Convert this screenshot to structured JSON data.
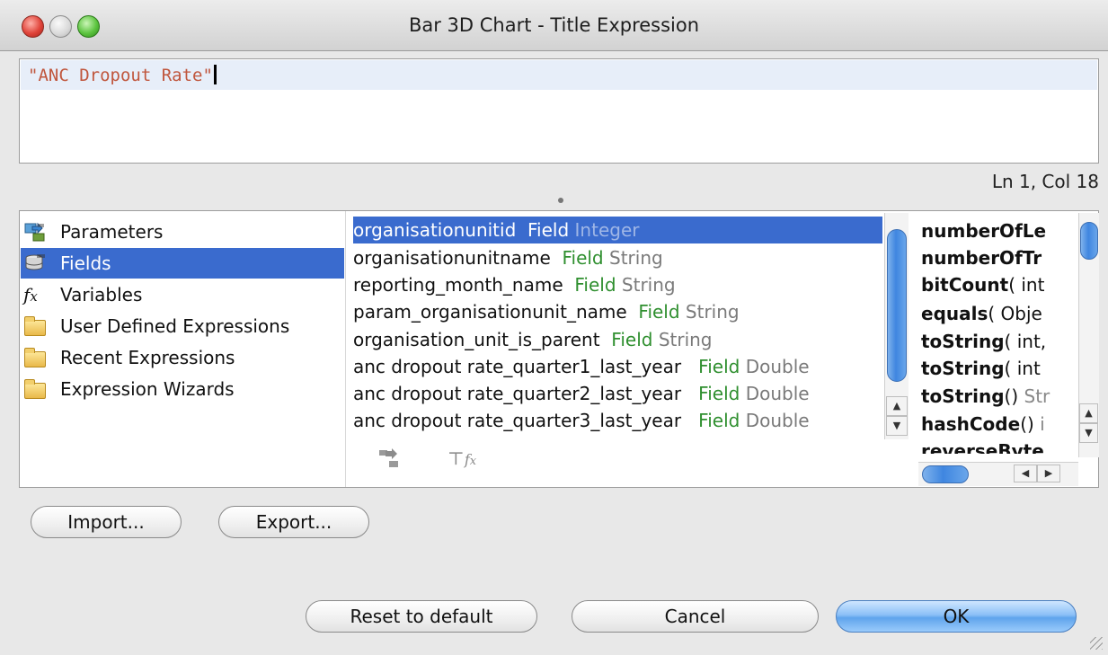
{
  "window": {
    "title": "Bar 3D Chart - Title Expression"
  },
  "editor": {
    "text": "\"ANC Dropout Rate\"",
    "cursor_position": "Ln 1, Col 18"
  },
  "tree": {
    "items": [
      {
        "label": "Parameters",
        "icon": "parameters-icon"
      },
      {
        "label": "Fields",
        "icon": "fields-icon",
        "selected": true
      },
      {
        "label": "Variables",
        "icon": "fx-icon"
      },
      {
        "label": "User Defined Expressions",
        "icon": "folder-icon"
      },
      {
        "label": "Recent Expressions",
        "icon": "folder-icon"
      },
      {
        "label": "Expression Wizards",
        "icon": "folder-icon"
      }
    ]
  },
  "fields": {
    "rows": [
      {
        "name": "organisationunitid",
        "kind": "Field",
        "type": "Integer",
        "selected": true
      },
      {
        "name": "organisationunitname",
        "kind": "Field",
        "type": "String"
      },
      {
        "name": "reporting_month_name",
        "kind": "Field",
        "type": "String"
      },
      {
        "name": "param_organisationunit_name",
        "kind": "Field",
        "type": "String"
      },
      {
        "name": "organisation_unit_is_parent",
        "kind": "Field",
        "type": "String"
      },
      {
        "name": "anc dropout rate_quarter1_last_year",
        "kind": "Field",
        "type": "Double"
      },
      {
        "name": "anc dropout rate_quarter2_last_year",
        "kind": "Field",
        "type": "Double"
      },
      {
        "name": "anc dropout rate_quarter3_last_year",
        "kind": "Field",
        "type": "Double"
      }
    ]
  },
  "methods": {
    "rows": [
      {
        "name": "numberOfLe",
        "args": "",
        "ret": ""
      },
      {
        "name": "numberOfTr",
        "args": "",
        "ret": ""
      },
      {
        "name": "bitCount",
        "args": "( int",
        "ret": ""
      },
      {
        "name": "equals",
        "args": "( Obje",
        "ret": ""
      },
      {
        "name": "toString",
        "args": "( int,",
        "ret": ""
      },
      {
        "name": "toString",
        "args": "( int",
        "ret": ""
      },
      {
        "name": "toString",
        "args": "()",
        "ret": "Str"
      },
      {
        "name": "hashCode",
        "args": "()",
        "ret": "i"
      },
      {
        "name": "reverseByte",
        "args": "",
        "ret": ""
      }
    ]
  },
  "buttons": {
    "import": "Import...",
    "export": "Export...",
    "reset": "Reset to default",
    "cancel": "Cancel",
    "ok": "OK"
  }
}
